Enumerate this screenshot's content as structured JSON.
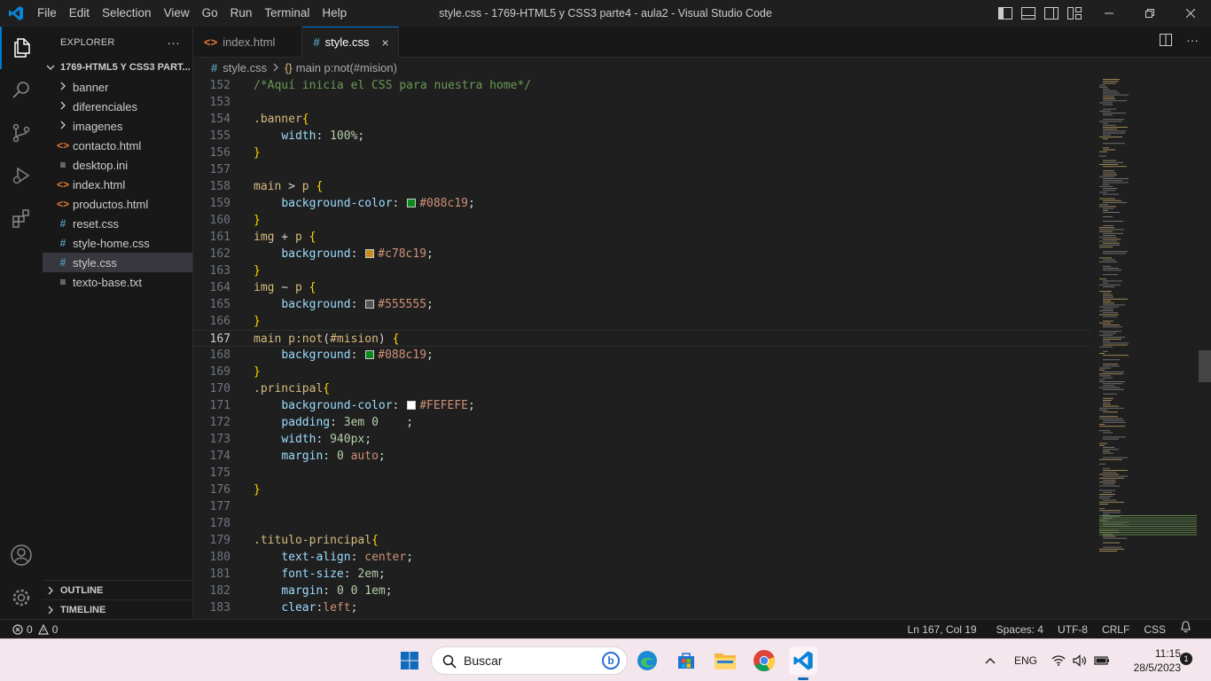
{
  "titlebar": {
    "menu": [
      "File",
      "Edit",
      "Selection",
      "View",
      "Go",
      "Run",
      "Terminal",
      "Help"
    ],
    "window_title": "style.css - 1769-HTML5 y CSS3 parte4 - aula2 - Visual Studio Code"
  },
  "explorer": {
    "header": "EXPLORER",
    "more": "···",
    "folder": "1769-HTML5 Y CSS3 PART...",
    "items": [
      {
        "label": "banner",
        "kind": "folder"
      },
      {
        "label": "diferenciales",
        "kind": "folder"
      },
      {
        "label": "imagenes",
        "kind": "folder"
      },
      {
        "label": "contacto.html",
        "kind": "html",
        "icon": "<>"
      },
      {
        "label": "desktop.ini",
        "kind": "file",
        "icon": "≡"
      },
      {
        "label": "index.html",
        "kind": "html",
        "icon": "<>"
      },
      {
        "label": "productos.html",
        "kind": "html",
        "icon": "<>"
      },
      {
        "label": "reset.css",
        "kind": "css",
        "icon": "#"
      },
      {
        "label": "style-home.css",
        "kind": "css",
        "icon": "#"
      },
      {
        "label": "style.css",
        "kind": "css",
        "icon": "#",
        "selected": true
      },
      {
        "label": "texto-base.txt",
        "kind": "file",
        "icon": "≡"
      }
    ],
    "outline": "OUTLINE",
    "timeline": "TIMELINE"
  },
  "tabs": [
    {
      "label": "index.html",
      "icon": "<>",
      "active": false
    },
    {
      "label": "style.css",
      "icon": "#",
      "active": true,
      "close": "×"
    }
  ],
  "breadcrumb": {
    "file": "style.css",
    "symbol": "main p:not(#mision)"
  },
  "editor": {
    "current_line": 167,
    "lines": [
      {
        "n": "152",
        "tokens": [
          [
            "comment",
            "/*Aquí inicia el CSS para nuestra home*/"
          ]
        ]
      },
      {
        "n": "153",
        "tokens": []
      },
      {
        "n": "154",
        "tokens": [
          [
            "sel",
            ".banner"
          ],
          [
            "brace",
            "{"
          ]
        ]
      },
      {
        "n": "155",
        "tokens": [
          [
            "punc",
            "    "
          ],
          [
            "prop",
            "width"
          ],
          [
            "punc",
            ": "
          ],
          [
            "num",
            "100%"
          ],
          [
            "punc",
            ";"
          ]
        ]
      },
      {
        "n": "156",
        "tokens": [
          [
            "brace",
            "}"
          ]
        ]
      },
      {
        "n": "157",
        "tokens": []
      },
      {
        "n": "158",
        "tokens": [
          [
            "sel",
            "main"
          ],
          [
            "punc",
            " > "
          ],
          [
            "sel",
            "p"
          ],
          [
            "punc",
            " "
          ],
          [
            "brace",
            "{"
          ]
        ]
      },
      {
        "n": "159",
        "tokens": [
          [
            "punc",
            "    "
          ],
          [
            "prop",
            "background-color"
          ],
          [
            "punc",
            ": "
          ],
          [
            "swatch",
            "#088c19"
          ],
          [
            "val",
            "#088c19"
          ],
          [
            "punc",
            ";"
          ]
        ]
      },
      {
        "n": "160",
        "tokens": [
          [
            "brace",
            "}"
          ]
        ]
      },
      {
        "n": "161",
        "tokens": [
          [
            "sel",
            "img"
          ],
          [
            "punc",
            " + "
          ],
          [
            "sel",
            "p"
          ],
          [
            "punc",
            " "
          ],
          [
            "brace",
            "{"
          ]
        ]
      },
      {
        "n": "162",
        "tokens": [
          [
            "punc",
            "    "
          ],
          [
            "prop",
            "background"
          ],
          [
            "punc",
            ": "
          ],
          [
            "swatch",
            "#c78c19"
          ],
          [
            "val",
            "#c78c19"
          ],
          [
            "punc",
            ";"
          ]
        ]
      },
      {
        "n": "163",
        "tokens": [
          [
            "brace",
            "}"
          ]
        ]
      },
      {
        "n": "164",
        "tokens": [
          [
            "sel",
            "img"
          ],
          [
            "punc",
            " ~ "
          ],
          [
            "sel",
            "p"
          ],
          [
            "punc",
            " "
          ],
          [
            "brace",
            "{"
          ]
        ]
      },
      {
        "n": "165",
        "tokens": [
          [
            "punc",
            "    "
          ],
          [
            "prop",
            "background"
          ],
          [
            "punc",
            ": "
          ],
          [
            "swatch",
            "#555555"
          ],
          [
            "val",
            "#555555"
          ],
          [
            "punc",
            ";"
          ]
        ]
      },
      {
        "n": "166",
        "tokens": [
          [
            "brace",
            "}"
          ]
        ]
      },
      {
        "n": "167",
        "tokens": [
          [
            "sel",
            "main p:not"
          ],
          [
            "punc",
            "("
          ],
          [
            "sel",
            "#mision"
          ],
          [
            "punc",
            ")"
          ],
          [
            "punc",
            " "
          ],
          [
            "brace",
            "{"
          ]
        ]
      },
      {
        "n": "168",
        "tokens": [
          [
            "punc",
            "    "
          ],
          [
            "prop",
            "background"
          ],
          [
            "punc",
            ": "
          ],
          [
            "swatch",
            "#088c19"
          ],
          [
            "val",
            "#088c19"
          ],
          [
            "punc",
            ";"
          ]
        ]
      },
      {
        "n": "169",
        "tokens": [
          [
            "brace",
            "}"
          ]
        ]
      },
      {
        "n": "170",
        "tokens": [
          [
            "sel",
            ".principal"
          ],
          [
            "brace",
            "{"
          ]
        ]
      },
      {
        "n": "171",
        "tokens": [
          [
            "punc",
            "    "
          ],
          [
            "prop",
            "background-color"
          ],
          [
            "punc",
            ": "
          ],
          [
            "swatch",
            "#FEFEFE"
          ],
          [
            "val",
            "#FEFEFE"
          ],
          [
            "punc",
            ";"
          ]
        ]
      },
      {
        "n": "172",
        "tokens": [
          [
            "punc",
            "    "
          ],
          [
            "prop",
            "padding"
          ],
          [
            "punc",
            ": "
          ],
          [
            "num",
            "3em 0"
          ],
          [
            "punc",
            "    ;"
          ]
        ]
      },
      {
        "n": "173",
        "tokens": [
          [
            "punc",
            "    "
          ],
          [
            "prop",
            "width"
          ],
          [
            "punc",
            ": "
          ],
          [
            "num",
            "940px"
          ],
          [
            "punc",
            ";"
          ]
        ]
      },
      {
        "n": "174",
        "tokens": [
          [
            "punc",
            "    "
          ],
          [
            "prop",
            "margin"
          ],
          [
            "punc",
            ": "
          ],
          [
            "num",
            "0"
          ],
          [
            "punc",
            " "
          ],
          [
            "val",
            "auto"
          ],
          [
            "punc",
            ";"
          ]
        ]
      },
      {
        "n": "175",
        "tokens": []
      },
      {
        "n": "176",
        "tokens": [
          [
            "brace",
            "}"
          ]
        ]
      },
      {
        "n": "177",
        "tokens": []
      },
      {
        "n": "178",
        "tokens": []
      },
      {
        "n": "179",
        "tokens": [
          [
            "sel",
            ".titulo-principal"
          ],
          [
            "brace",
            "{"
          ]
        ]
      },
      {
        "n": "180",
        "tokens": [
          [
            "punc",
            "    "
          ],
          [
            "prop",
            "text-align"
          ],
          [
            "punc",
            ": "
          ],
          [
            "val",
            "center"
          ],
          [
            "punc",
            ";"
          ]
        ]
      },
      {
        "n": "181",
        "tokens": [
          [
            "punc",
            "    "
          ],
          [
            "prop",
            "font-size"
          ],
          [
            "punc",
            ": "
          ],
          [
            "num",
            "2em"
          ],
          [
            "punc",
            ";"
          ]
        ]
      },
      {
        "n": "182",
        "tokens": [
          [
            "punc",
            "    "
          ],
          [
            "prop",
            "margin"
          ],
          [
            "punc",
            ": "
          ],
          [
            "num",
            "0 0 1em"
          ],
          [
            "punc",
            ";"
          ]
        ]
      },
      {
        "n": "183",
        "tokens": [
          [
            "punc",
            "    "
          ],
          [
            "prop",
            "clear"
          ],
          [
            "punc",
            ":"
          ],
          [
            "val",
            "left"
          ],
          [
            "punc",
            ";"
          ]
        ]
      }
    ]
  },
  "statusbar": {
    "errors": "0",
    "warnings": "0",
    "position": "Ln 167, Col 19",
    "spaces": "Spaces: 4",
    "encoding": "UTF-8",
    "eol": "CRLF",
    "language": "CSS"
  },
  "taskbar": {
    "search_label": "Buscar",
    "language": "ENG",
    "time": "11:15",
    "date": "28/5/2023",
    "notifications": "1"
  },
  "colors": {
    "accent": "#0078d4",
    "editor_bg": "#1f1f1f",
    "sidebar_bg": "#181818"
  }
}
